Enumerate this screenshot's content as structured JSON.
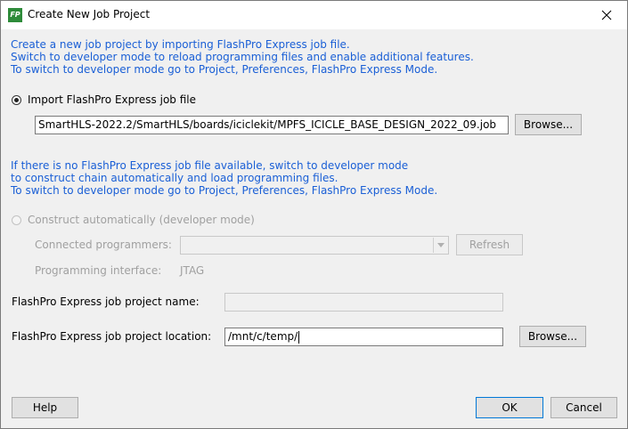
{
  "window": {
    "title": "Create New Job Project",
    "app_icon_text": "FP",
    "close_symbol": "✕",
    "icons": {
      "app": "flashpro-app-icon",
      "close": "close-icon",
      "combo": "chevron-down-icon"
    }
  },
  "intro": {
    "line1": "Create a new job project by importing FlashPro Express job file.",
    "line2": "Switch to developer mode to reload programming files and enable additional features.",
    "line3": "To switch to developer mode go to Project, Preferences, FlashPro Express Mode."
  },
  "import": {
    "radio_label": "Import FlashPro Express job file",
    "selected": true,
    "path_value": "SmartHLS-2022.2/SmartHLS/boards/iciclekit/MPFS_ICICLE_BASE_DESIGN_2022_09.job",
    "browse_label": "Browse..."
  },
  "info2": {
    "line1": "If there is no FlashPro Express job file available, switch to developer mode",
    "line2": "to construct chain automatically and load programming files.",
    "line3": "To switch to developer mode go to Project, Preferences, FlashPro Express Mode."
  },
  "construct": {
    "radio_label": "Construct automatically (developer mode)",
    "selected": false,
    "programmers_label": "Connected programmers:",
    "programmers_value": "",
    "refresh_label": "Refresh",
    "interface_label": "Programming interface:",
    "interface_value": "JTAG"
  },
  "project": {
    "name_label": "FlashPro Express job project name:",
    "name_value": "",
    "location_label": "FlashPro Express job project location:",
    "location_value": "/mnt/c/temp/",
    "browse_label": "Browse..."
  },
  "footer": {
    "help_label": "Help",
    "ok_label": "OK",
    "cancel_label": "Cancel"
  },
  "colors": {
    "info_text": "#1a5fd6",
    "dialog_bg": "#f0f0f0",
    "button_bg": "#e1e1e1",
    "disabled_text": "#a0a0a0"
  }
}
